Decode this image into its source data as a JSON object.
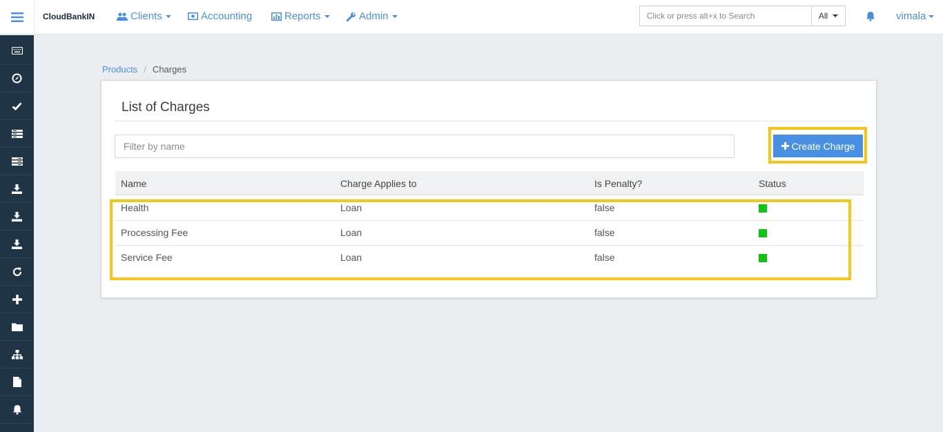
{
  "app": {
    "brand": "CloudBankIN"
  },
  "topnav": {
    "items": [
      {
        "label": "Clients",
        "icon": "users-icon",
        "dropdown": true
      },
      {
        "label": "Accounting",
        "icon": "money-icon",
        "dropdown": false
      },
      {
        "label": "Reports",
        "icon": "bar-chart-icon",
        "dropdown": true
      },
      {
        "label": "Admin",
        "icon": "wrench-icon",
        "dropdown": true
      }
    ],
    "search": {
      "placeholder": "Click or press alt+x to Search",
      "value": "",
      "scope": "All"
    },
    "user": "vimala"
  },
  "sidebar": {
    "icons": [
      "keyboard-icon",
      "compass-icon",
      "check-icon",
      "list-icon",
      "list-alt-icon",
      "download-icon",
      "download-icon",
      "download-icon",
      "refresh-icon",
      "plus-icon",
      "folder-icon",
      "sitemap-icon",
      "file-icon",
      "bell-icon"
    ]
  },
  "breadcrumb": {
    "parent": "Products",
    "separator": "/",
    "current": "Charges"
  },
  "card": {
    "title": "List of Charges",
    "filter": {
      "placeholder": "Filter by name",
      "value": ""
    },
    "create_button": "Create Charge"
  },
  "table": {
    "headers": [
      "Name",
      "Charge Applies to",
      "Is Penalty?",
      "Status"
    ],
    "rows": [
      {
        "name": "Health",
        "applies_to": "Loan",
        "is_penalty": "false",
        "status": "active"
      },
      {
        "name": "Processing Fee",
        "applies_to": "Loan",
        "is_penalty": "false",
        "status": "active"
      },
      {
        "name": "Service Fee",
        "applies_to": "Loan",
        "is_penalty": "false",
        "status": "active"
      }
    ]
  },
  "colors": {
    "accent": "#4a90e2",
    "sidebar": "#1f3547",
    "status_active": "#12c412",
    "highlight": "#f5c518"
  }
}
